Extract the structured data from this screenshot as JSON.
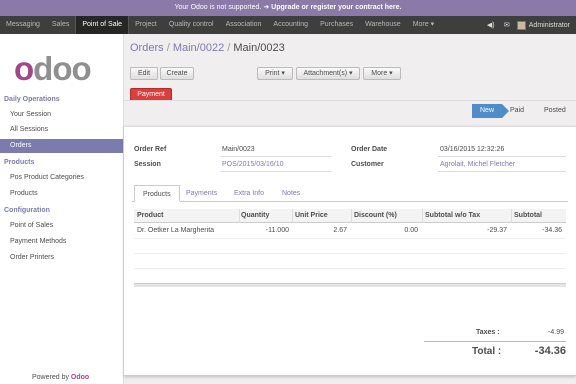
{
  "banner": {
    "prefix": "Your Odoo is not supported.",
    "link": "Upgrade or register your contract here."
  },
  "topnav": {
    "items": [
      "Messaging",
      "Sales",
      "Point of Sale",
      "Project",
      "Quality control",
      "Association",
      "Accounting",
      "Purchases",
      "Warehouse",
      "More"
    ],
    "user": "Administrator"
  },
  "sidebar": {
    "logo": {
      "first": "o",
      "rest": "doo"
    },
    "sections": [
      {
        "title": "Daily Operations",
        "items": [
          "Your Session",
          "All Sessions",
          "Orders"
        ]
      },
      {
        "title": "Products",
        "items": [
          "Pos Product Categories",
          "Products"
        ]
      },
      {
        "title": "Configuration",
        "items": [
          "Point of Sales",
          "Payment Methods",
          "Order Printers"
        ]
      }
    ],
    "active_item": "Orders",
    "powered_by": "Powered by",
    "powered_brand": "Odoo"
  },
  "breadcrumb": {
    "items": [
      "Orders",
      "Main/0022"
    ],
    "current": "Main/0023",
    "separator": "/"
  },
  "toolbar": {
    "edit": "Edit",
    "create": "Create",
    "print": "Print ▾",
    "attachments": "Attachment(s) ▾",
    "more": "More ▾"
  },
  "payment_button": "Payment",
  "status": {
    "steps": [
      "New",
      "Paid",
      "Posted"
    ],
    "active": "New"
  },
  "form": {
    "order_ref_label": "Order Ref",
    "order_ref": "Main/0023",
    "session_label": "Session",
    "session": "POS/2015/03/16/10",
    "order_date_label": "Order Date",
    "order_date": "03/16/2015 12:32:26",
    "customer_label": "Customer",
    "customer": "Agrolait, Michel Fletcher"
  },
  "tabs": [
    "Products",
    "Payments",
    "Extra Info",
    "Notes"
  ],
  "lines": {
    "headers": [
      "Product",
      "Quantity",
      "Unit Price",
      "Discount (%)",
      "Subtotal w/o Tax",
      "Subtotal"
    ],
    "rows": [
      [
        "Dr. Oetker La Margherita",
        "-11.000",
        "2.67",
        "0.00",
        "-29.37",
        "-34.36"
      ]
    ]
  },
  "totals": {
    "taxes_label": "Taxes :",
    "taxes": "-4.99",
    "total_label": "Total :",
    "total": "-34.36"
  },
  "colors": {
    "accent": "#7c7bad",
    "brand": "#a24689",
    "danger": "#dc3d3d",
    "status_active": "#4f8cc9",
    "banner": "#8b79a7"
  }
}
